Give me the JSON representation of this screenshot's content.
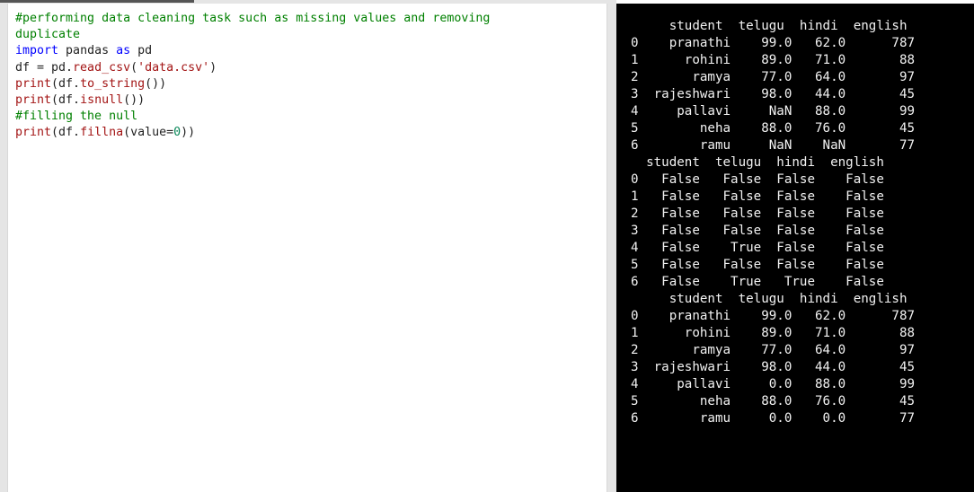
{
  "editor": {
    "lines": [
      [
        {
          "t": "#performing data cleaning task such as missing values and removing",
          "c": "comment"
        }
      ],
      [
        {
          "t": "duplicate",
          "c": "comment"
        }
      ],
      [
        {
          "t": "import",
          "c": "keyword"
        },
        {
          "t": " pandas ",
          "c": ""
        },
        {
          "t": "as",
          "c": "keyword"
        },
        {
          "t": " pd",
          "c": ""
        }
      ],
      [
        {
          "t": "df = pd.",
          "c": ""
        },
        {
          "t": "read_csv",
          "c": "func"
        },
        {
          "t": "(",
          "c": ""
        },
        {
          "t": "'data.csv'",
          "c": "string"
        },
        {
          "t": ")",
          "c": ""
        }
      ],
      [
        {
          "t": "print",
          "c": "func"
        },
        {
          "t": "(df.",
          "c": ""
        },
        {
          "t": "to_string",
          "c": "func"
        },
        {
          "t": "())",
          "c": ""
        }
      ],
      [
        {
          "t": "print",
          "c": "func"
        },
        {
          "t": "(df.",
          "c": ""
        },
        {
          "t": "isnull",
          "c": "func"
        },
        {
          "t": "())",
          "c": ""
        }
      ],
      [
        {
          "t": "#filling the null",
          "c": "comment"
        }
      ],
      [
        {
          "t": "print",
          "c": "func"
        },
        {
          "t": "(df.",
          "c": ""
        },
        {
          "t": "fillna",
          "c": "func"
        },
        {
          "t": "(value=",
          "c": ""
        },
        {
          "t": "0",
          "c": "number"
        },
        {
          "t": "))",
          "c": ""
        }
      ]
    ]
  },
  "output": {
    "lines": [
      "     student  telugu  hindi  english",
      "0    pranathi    99.0   62.0      787",
      "1      rohini    89.0   71.0       88",
      "2       ramya    77.0   64.0       97",
      "3  rajeshwari    98.0   44.0       45",
      "4     pallavi     NaN   88.0       99",
      "5        neha    88.0   76.0       45",
      "6        ramu     NaN    NaN       77",
      "  student  telugu  hindi  english",
      "0   False   False  False    False",
      "1   False   False  False    False",
      "2   False   False  False    False",
      "3   False   False  False    False",
      "4   False    True  False    False",
      "5   False   False  False    False",
      "6   False    True   True    False",
      "     student  telugu  hindi  english",
      "0    pranathi    99.0   62.0      787",
      "1      rohini    89.0   71.0       88",
      "2       ramya    77.0   64.0       97",
      "3  rajeshwari    98.0   44.0       45",
      "4     pallavi     0.0   88.0       99",
      "5        neha    88.0   76.0       45",
      "6        ramu     0.0    0.0       77"
    ]
  }
}
